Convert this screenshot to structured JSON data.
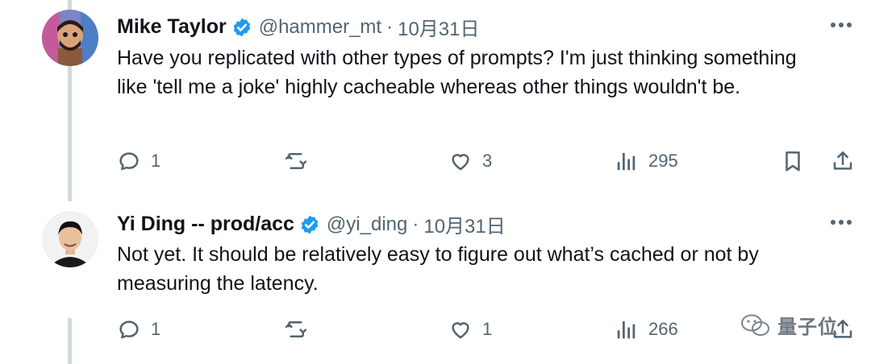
{
  "tweets": [
    {
      "name": "Mike Taylor",
      "handle": "@hammer_mt",
      "separator": "·",
      "date": "10月31日",
      "text": "Have you replicated with other types of prompts? I'm just thinking something like 'tell me a joke' highly cacheable whereas other things wouldn't be.",
      "replies": "1",
      "likes": "3",
      "views": "295"
    },
    {
      "name": "Yi Ding -- prod/acc",
      "handle": "@yi_ding",
      "separator": "·",
      "date": "10月31日",
      "text": "Not yet. It should be relatively easy to figure out what’s cached or not by measuring the latency.",
      "replies": "1",
      "likes": "1",
      "views": "266"
    }
  ],
  "watermark": {
    "text": "量子位"
  },
  "colors": {
    "text": "#0f1419",
    "muted": "#536471",
    "verified": "#1d9bf0",
    "thread_line": "#cfd9de"
  }
}
